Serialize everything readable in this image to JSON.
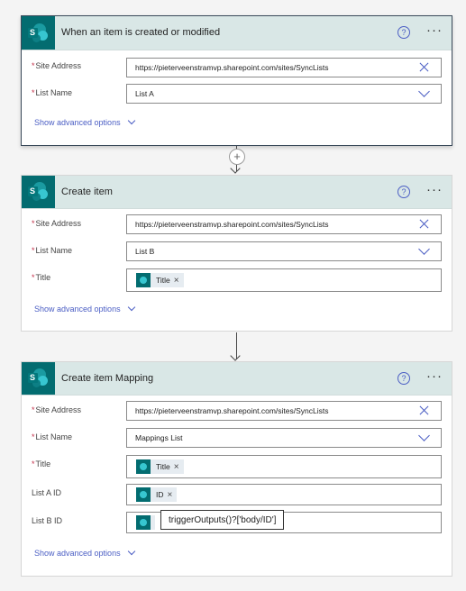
{
  "cards": [
    {
      "title": "When an item is created or modified",
      "fields": [
        {
          "label": "Site Address",
          "value": "https://pieterveenstramvp.sharepoint.com/sites/SyncLists"
        },
        {
          "label": "List Name",
          "value": "List A"
        }
      ],
      "advanced_label": "Show advanced options"
    },
    {
      "title": "Create item",
      "fields": [
        {
          "label": "Site Address",
          "value": "https://pieterveenstramvp.sharepoint.com/sites/SyncLists"
        },
        {
          "label": "List Name",
          "value": "List B"
        },
        {
          "label": "Title",
          "token": "Title"
        }
      ],
      "advanced_label": "Show advanced options"
    },
    {
      "title": "Create item Mapping",
      "fields": [
        {
          "label": "Site Address",
          "value": "https://pieterveenstramvp.sharepoint.com/sites/SyncLists"
        },
        {
          "label": "List Name",
          "value": "Mappings List"
        },
        {
          "label": "Title",
          "token": "Title"
        },
        {
          "label": "List A ID",
          "token": "ID"
        },
        {
          "label": "List B ID"
        }
      ],
      "advanced_label": "Show advanced options"
    }
  ],
  "required_marker": "*",
  "help_glyph": "?",
  "more_glyph": "···",
  "token_remove_glyph": "×",
  "add_step_glyph": "+",
  "tooltip": "triggerOutputs()?['body/ID']",
  "colors": {
    "header_bg": "#d9e7e6",
    "sharepoint": "#036c70",
    "accent": "#4b5ec4",
    "required": "#c4314b"
  }
}
